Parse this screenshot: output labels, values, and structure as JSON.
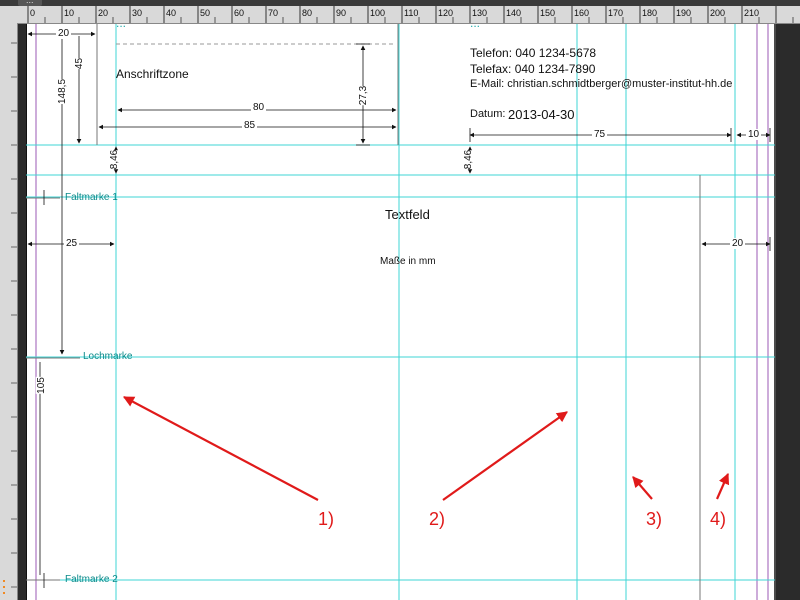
{
  "app": {
    "document_tab": "...",
    "ruler_unit": "mm"
  },
  "ruler": {
    "ticks": [
      "0",
      "10",
      "20",
      "30",
      "40",
      "50",
      "60",
      "70",
      "80",
      "90",
      "100",
      "110",
      "120",
      "130",
      "140",
      "150",
      "160",
      "170",
      "180",
      "190",
      "200",
      "210"
    ]
  },
  "sender_line": "...",
  "address_zone": {
    "label": "Anschriftzone",
    "dim_20": "20",
    "dim_45": "45",
    "dim_148_5": "148,5",
    "dim_27_3": "27,3",
    "dim_80": "80",
    "dim_85": "85"
  },
  "info_block": {
    "header": "...",
    "phone": "Telefon: 040 1234-5678",
    "fax": "Telefax: 040 1234-7890",
    "email": "E-Mail: christian.schmidtberger@muster-institut-hh.de",
    "date_label": "Datum:",
    "date_value": "2013-04-30",
    "dim_75": "75",
    "dim_10": "10"
  },
  "offsets": {
    "left": "8,46",
    "right": "8,46"
  },
  "marks": {
    "fold1": "Faltmarke 1",
    "punch": "Lochmarke",
    "fold2": "Faltmarke 2",
    "dim_105": "105"
  },
  "text_field": {
    "title": "Textfeld",
    "subtitle": "Maße in mm",
    "dim_25": "25",
    "dim_20": "20"
  },
  "annotations": [
    "1)",
    "2)",
    "3)",
    "4)"
  ],
  "colors": {
    "guide": "#3fd6d6",
    "margin": "#9b59b6",
    "annotation": "#e01a1a",
    "ruler": "#d9d9d9"
  }
}
